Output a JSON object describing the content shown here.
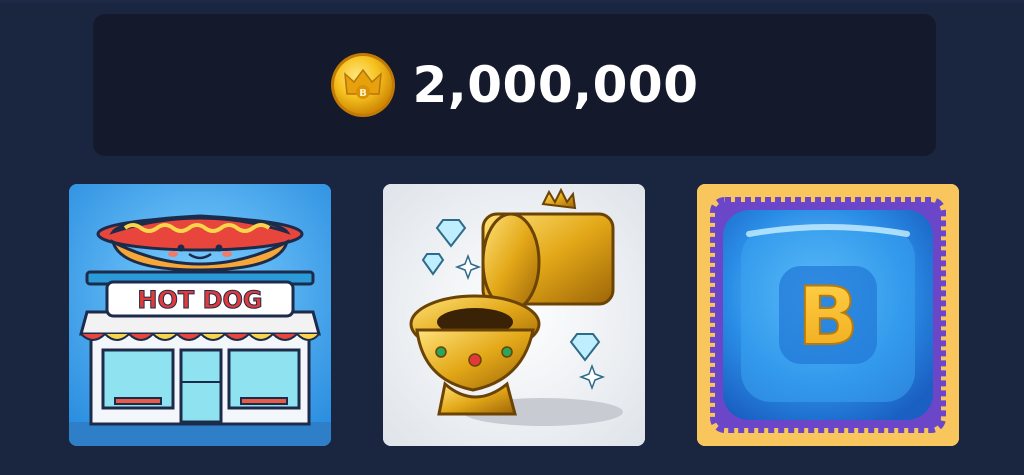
{
  "balance": {
    "amount": "2,000,000",
    "coin_icon": "crown-coin-icon",
    "coin_letter": "B"
  },
  "cards": [
    {
      "name": "hot-dog-shop-card",
      "sign_text": "HOT DOG",
      "bg_color": "#3aa0e8"
    },
    {
      "name": "golden-toilet-card",
      "bg_color": "#edf0f3"
    },
    {
      "name": "blue-cube-card",
      "letter": "B",
      "bg_color": "#f8c65d"
    }
  ],
  "colors": {
    "page_bg": "#1a2640",
    "panel_bg": "#141a2c",
    "coin_gold": "#f4b512",
    "text": "#ffffff"
  }
}
